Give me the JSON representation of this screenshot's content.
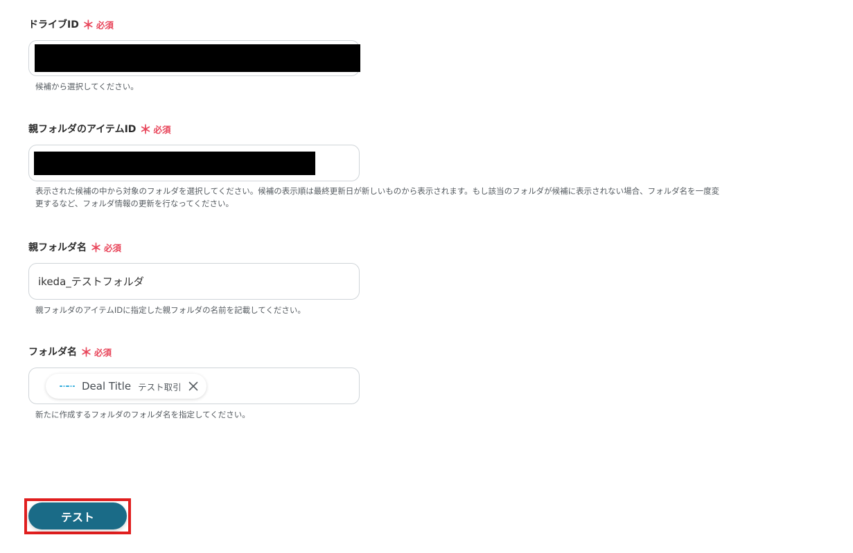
{
  "fields": [
    {
      "label": "ドライブID",
      "required_star": "＊",
      "required_text": "必須",
      "value": "",
      "redacted": true,
      "help": "候補から選択してください。"
    },
    {
      "label": "親フォルダのアイテムID",
      "required_star": "＊",
      "required_text": "必須",
      "value": "",
      "redacted": true,
      "help_line1": "表示された候補の中から対象のフォルダを選択してください。候補の表示順は最終更新日が新しいものから表示されます。もし該当のフォルダが候補に表示されない場合、フォルダ名を一度変",
      "help_line2": "更するなど、フォルダ情報の更新を行なってください。"
    },
    {
      "label": "親フォルダ名",
      "required_star": "＊",
      "required_text": "必須",
      "value": "ikeda_テストフォルダ",
      "help": "親フォルダのアイテムIDに指定した親フォルダの名前を記載してください。"
    },
    {
      "label": "フォルダ名",
      "required_star": "＊",
      "required_text": "必須",
      "chip": {
        "logo_icon": "app-logo-icon",
        "title": "Deal Title",
        "subtitle": "テスト取引",
        "close_icon": "close-icon"
      },
      "help": "新たに作成するフォルダのフォルダ名を指定してください。"
    }
  ],
  "test_button_label": "テスト",
  "colors": {
    "required": "#e8455a",
    "button": "#1a6b87",
    "highlight": "#e01e1e",
    "border": "#cfd4d8"
  }
}
